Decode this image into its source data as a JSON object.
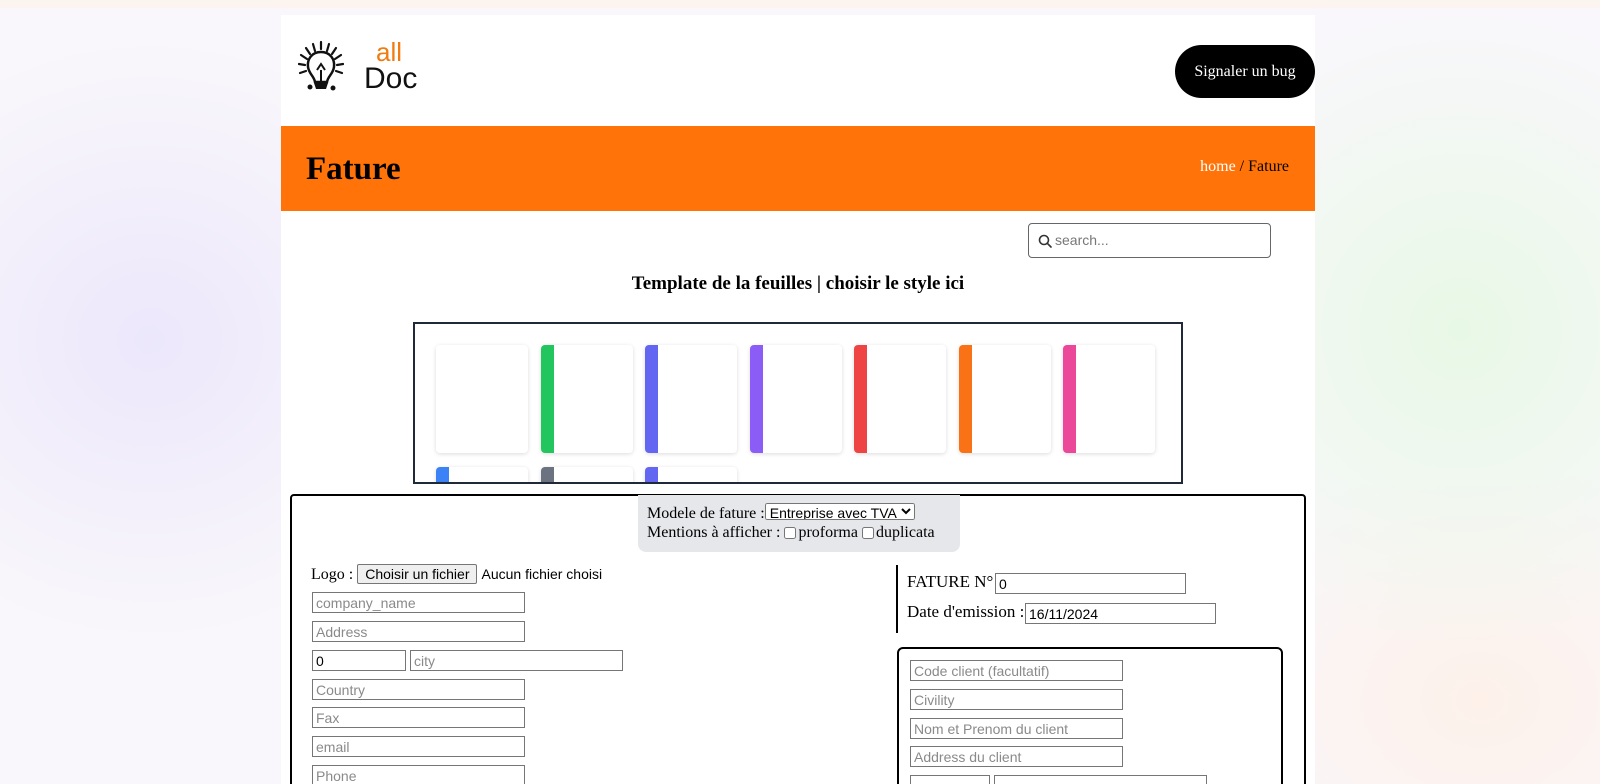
{
  "brand": {
    "logo_top": "all",
    "logo_bottom": "Doc"
  },
  "header": {
    "bug_button": "Signaler un bug"
  },
  "banner": {
    "title": "Fature",
    "breadcrumb": {
      "home": "home",
      "separator": "/",
      "current": "Fature"
    }
  },
  "search": {
    "placeholder": "search..."
  },
  "templates": {
    "title": "Template de la feuilles | choisir le style ici",
    "colors": [
      "#ffffff",
      "#22c55e",
      "#6366f1",
      "#8b5cf6",
      "#ef4444",
      "#f97316",
      "#ec4899",
      "#3b82f6",
      "#6b7280",
      "#6366f1"
    ]
  },
  "options": {
    "model_label": "Modele de fature :",
    "model_selected": "Entreprise avec TVA",
    "mentions_label": "Mentions à afficher :",
    "proforma_label": "proforma",
    "duplicata_label": "duplicata"
  },
  "company": {
    "logo_label": "Logo :",
    "file_button": "Choisir un fichier",
    "file_status": "Aucun fichier choisi",
    "name_placeholder": "company_name",
    "address_placeholder": "Address",
    "postal_value": "0",
    "city_placeholder": "city",
    "country_placeholder": "Country",
    "fax_placeholder": "Fax",
    "email_placeholder": "email",
    "phone_placeholder": "Phone"
  },
  "invoice": {
    "number_label": "FATURE N°",
    "number_value": "0",
    "date_label": "Date d'emission :",
    "date_value": "16/11/2024"
  },
  "client": {
    "code_placeholder": "Code client (facultatif)",
    "civility_placeholder": "Civility",
    "name_placeholder": "Nom et Prenom du client",
    "address_placeholder": "Address du client"
  }
}
